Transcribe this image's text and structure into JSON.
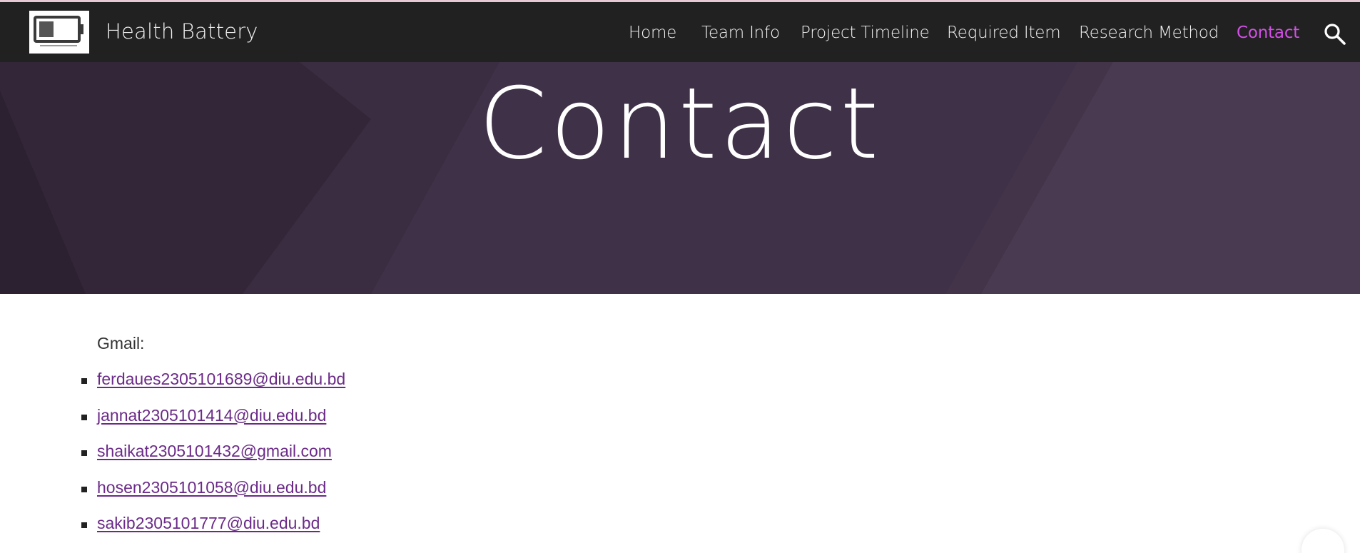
{
  "header": {
    "site_title": "Health Battery",
    "logo_icon": "battery-icon",
    "nav": [
      {
        "label": "Home",
        "active": false
      },
      {
        "label": "Team Info",
        "active": false
      },
      {
        "label": "Project Timeline",
        "active": false
      },
      {
        "label": "Required Item",
        "active": false
      },
      {
        "label": "Research Method",
        "active": false
      },
      {
        "label": "Contact",
        "active": true
      }
    ],
    "search_icon": "search-icon",
    "active_color": "#d44fe8",
    "bar_color": "#212121"
  },
  "hero": {
    "title": "Contact",
    "bg_color": "#3f3146"
  },
  "main": {
    "gmail_label": "Gmail:",
    "emails": [
      "ferdaues2305101689@diu.edu.bd",
      "jannat2305101414@diu.edu.bd",
      "shaikat2305101432@gmail.com",
      "hosen2305101058@diu.edu.bd",
      "sakib2305101777@diu.edu.bd"
    ],
    "link_color": "#6b2a88"
  }
}
